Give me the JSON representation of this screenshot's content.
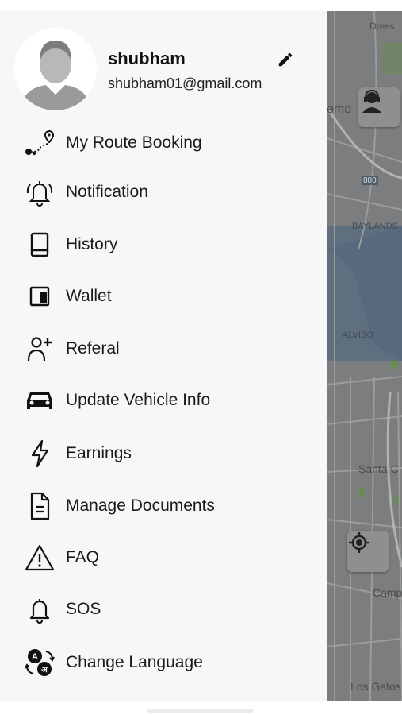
{
  "profile": {
    "name": "shubham",
    "email": "shubham01@gmail.com"
  },
  "menu": [
    {
      "label": "My Route Booking",
      "icon": "route-icon"
    },
    {
      "label": "Notification",
      "icon": "bell-ringing-icon"
    },
    {
      "label": "History",
      "icon": "book-icon"
    },
    {
      "label": "Wallet",
      "icon": "wallet-icon"
    },
    {
      "label": "Referal",
      "icon": "add-person-icon"
    },
    {
      "label": "Update Vehicle Info",
      "icon": "car-icon"
    },
    {
      "label": "Earnings",
      "icon": "lightning-icon"
    },
    {
      "label": "Manage Documents",
      "icon": "document-icon"
    },
    {
      "label": "FAQ",
      "icon": "warning-icon"
    },
    {
      "label": "SOS",
      "icon": "bell-icon"
    },
    {
      "label": "Change Language",
      "icon": "translate-icon"
    }
  ],
  "map": {
    "labels": [
      "Dress",
      "emo",
      "880",
      "BAYLANDS",
      "ALVISO",
      "Santa C",
      "Camp",
      "Los Gatos"
    ]
  },
  "colors": {
    "drawer_bg": "#f7f7f7",
    "map_overlay": "#7b7d7e",
    "text": "#1a1a1a"
  }
}
